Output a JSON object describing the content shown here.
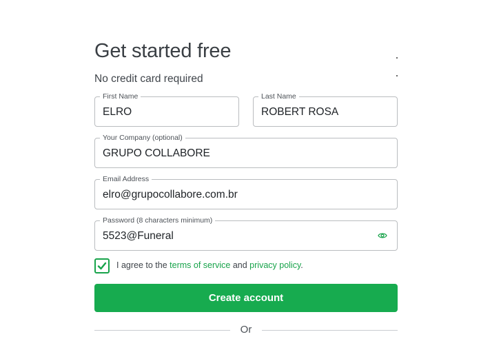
{
  "header": {
    "title": "Get started free",
    "subtitle": "No credit card required"
  },
  "fields": {
    "first_name": {
      "label": "First Name",
      "value": "ELRO"
    },
    "last_name": {
      "label": "Last Name",
      "value": "ROBERT ROSA"
    },
    "company": {
      "label": "Your Company (optional)",
      "value": "GRUPO COLLABORE"
    },
    "email": {
      "label": "Email Address",
      "value": "elro@grupocollabore.com.br"
    },
    "password": {
      "label": "Password (8 characters minimum)",
      "value": "5523@Funeral",
      "toggle_icon": "eye-icon"
    }
  },
  "agreement": {
    "checked": true,
    "prefix": "I agree to the ",
    "terms": "terms of service",
    "middle": " and ",
    "privacy": "privacy policy",
    "suffix": "."
  },
  "actions": {
    "create_account": "Create account",
    "divider": "Or"
  },
  "colors": {
    "accent": "#17ab4f",
    "link": "#17a34a",
    "border": "#b9bcbf",
    "text": "#2b2f33"
  }
}
